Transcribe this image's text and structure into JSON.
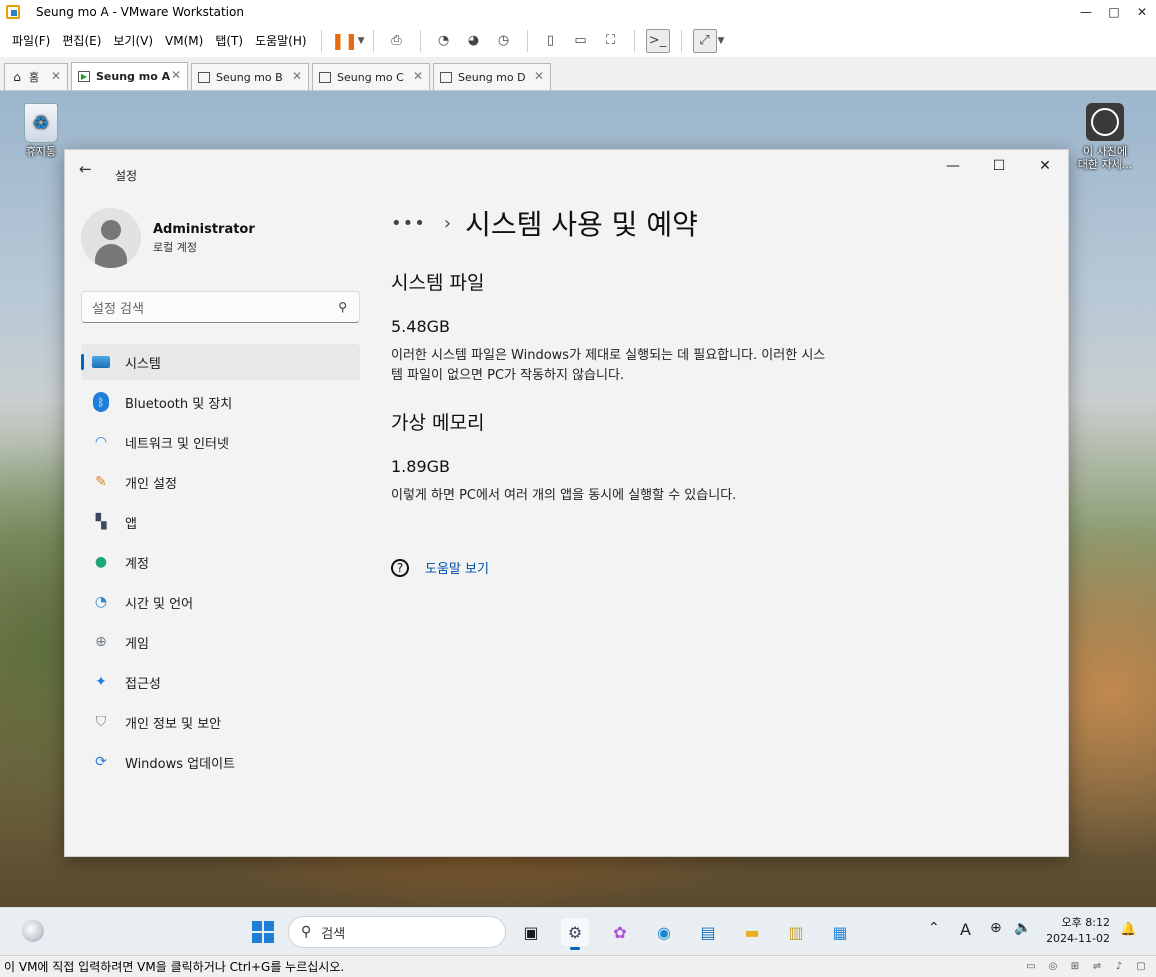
{
  "window": {
    "title": "Seung mo A - VMware Workstation",
    "controls": {
      "minimize": "—",
      "maximize": "□",
      "close": "✕"
    }
  },
  "menu": [
    "파일(F)",
    "편집(E)",
    "보기(V)",
    "VM(M)",
    "탭(T)",
    "도움말(H)"
  ],
  "tabs": [
    {
      "label": "홈",
      "icon": "home-icon"
    },
    {
      "label": "Seung mo A",
      "icon": "vm-running-icon",
      "active": true
    },
    {
      "label": "Seung mo B",
      "icon": "vm-icon"
    },
    {
      "label": "Seung mo C",
      "icon": "vm-icon"
    },
    {
      "label": "Seung mo D",
      "icon": "vm-icon"
    }
  ],
  "desktop": {
    "recycle_bin": "휴지통",
    "photo_info_line1": "이 사진에",
    "photo_info_line2": "대한 자세..."
  },
  "settings": {
    "app_title": "설정",
    "profile": {
      "name": "Administrator",
      "account_type": "로컬 계정"
    },
    "search_placeholder": "설정 검색",
    "nav": [
      {
        "label": "시스템",
        "icon": "monitor-icon",
        "active": true
      },
      {
        "label": "Bluetooth 및 장치",
        "icon": "bluetooth-icon"
      },
      {
        "label": "네트워크 및 인터넷",
        "icon": "wifi-icon"
      },
      {
        "label": "개인 설정",
        "icon": "brush-icon"
      },
      {
        "label": "앱",
        "icon": "apps-icon"
      },
      {
        "label": "계정",
        "icon": "person-icon"
      },
      {
        "label": "시간 및 언어",
        "icon": "clock-globe-icon"
      },
      {
        "label": "게임",
        "icon": "gamepad-icon"
      },
      {
        "label": "접근성",
        "icon": "accessibility-icon"
      },
      {
        "label": "개인 정보 및 보안",
        "icon": "shield-icon"
      },
      {
        "label": "Windows 업데이트",
        "icon": "update-icon"
      }
    ],
    "breadcrumb_dots": "•••",
    "page_title": "시스템 사용 및 예약",
    "sections": [
      {
        "title": "시스템 파일",
        "value": "5.48GB",
        "description": "이러한 시스템 파일은 Windows가 제대로 실행되는 데 필요합니다. 이러한 시스템 파일이 없으면 PC가 작동하지 않습니다."
      },
      {
        "title": "가상 메모리",
        "value": "1.89GB",
        "description": "이렇게 하면 PC에서 여러 개의 앱을 동시에 실행할 수 있습니다."
      }
    ],
    "help_link": "도움말 보기"
  },
  "taskbar": {
    "search_placeholder": "검색",
    "tray_ime": "A",
    "time": "오후 8:12",
    "date": "2024-11-02"
  },
  "statusbar": {
    "message": "이 VM에 직접 입력하려면 VM을 클릭하거나 Ctrl+G를 누르십시오."
  },
  "colors": {
    "accent": "#0067c0",
    "pause": "#e86a10"
  }
}
